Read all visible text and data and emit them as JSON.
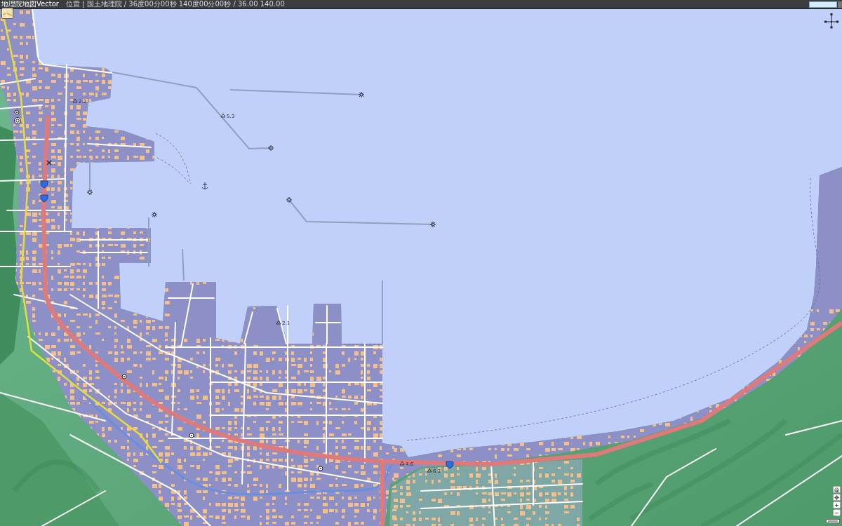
{
  "header": {
    "logo": "地理院地図Vector",
    "location": "位置 | 国土地理院 / 36度00分00秒 140度00分00秒 / 36.00 140.00"
  },
  "map": {
    "spot_heights": [
      {
        "value": "5.3"
      },
      {
        "value": "2.2"
      },
      {
        "value": "2.1"
      },
      {
        "value": "4.6"
      },
      {
        "value": "6.2"
      }
    ]
  }
}
